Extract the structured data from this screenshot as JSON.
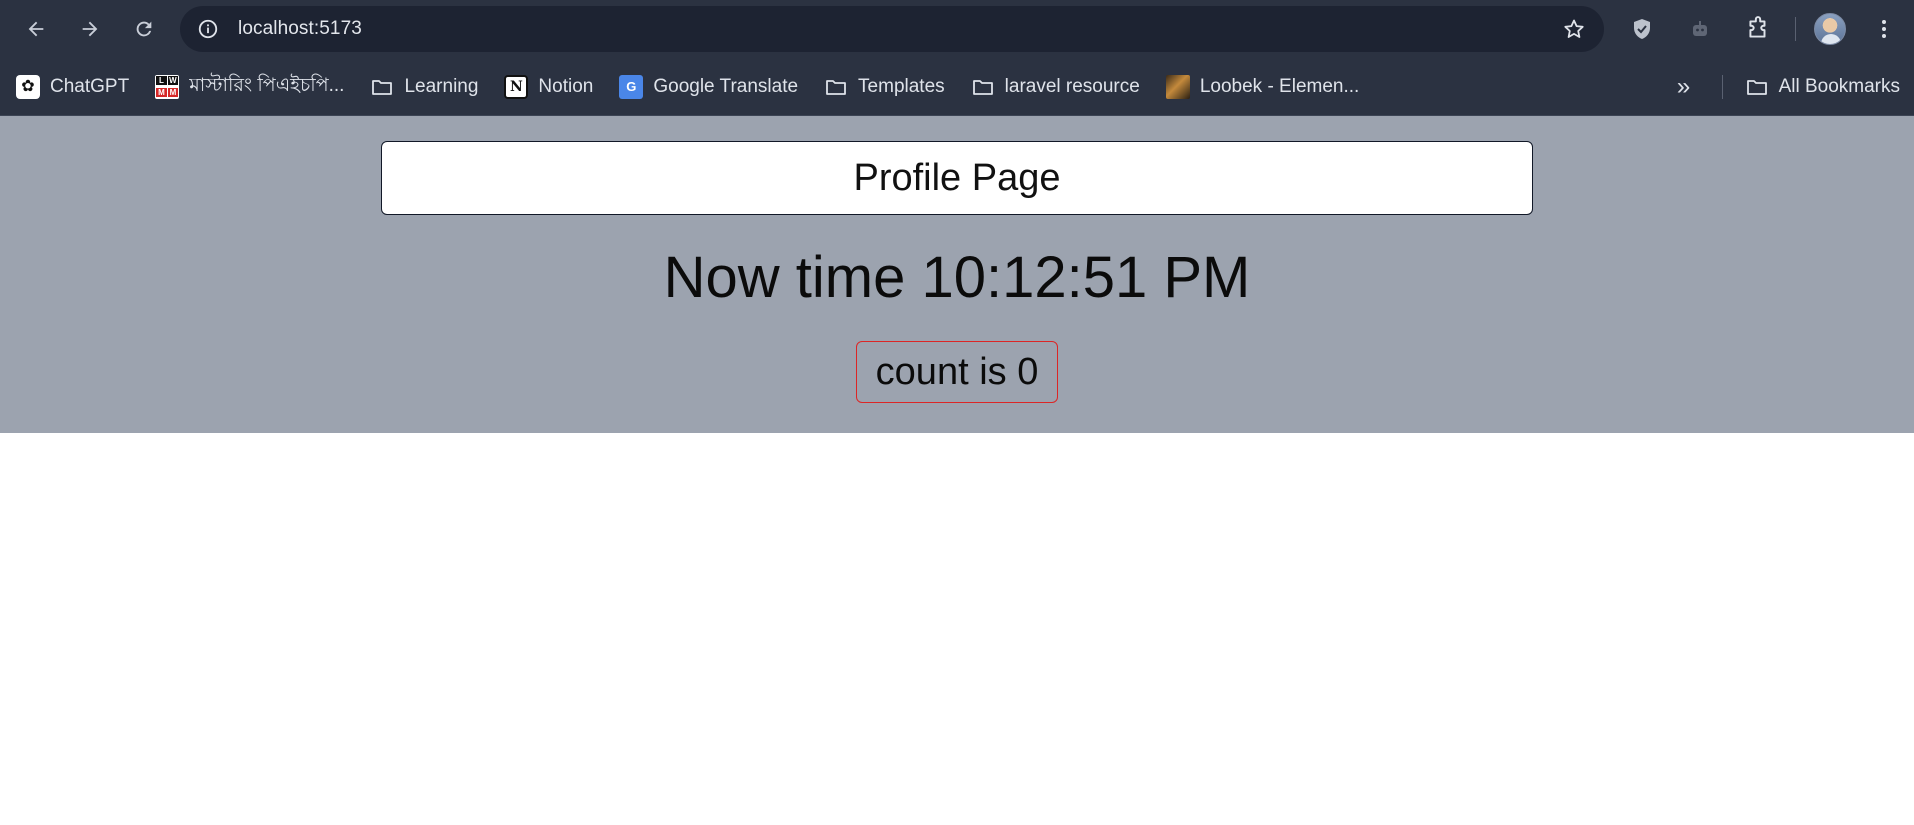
{
  "browser": {
    "url": "localhost:5173",
    "bookmarks": [
      {
        "label": "ChatGPT",
        "icon": "chatgpt-icon"
      },
      {
        "label": "মাস্টারিং পিএইচপি...",
        "icon": "lwm-icon"
      },
      {
        "label": "Learning",
        "icon": "folder-icon"
      },
      {
        "label": "Notion",
        "icon": "notion-icon"
      },
      {
        "label": "Google Translate",
        "icon": "google-translate-icon"
      },
      {
        "label": "Templates",
        "icon": "folder-icon"
      },
      {
        "label": "laravel resource",
        "icon": "folder-icon"
      },
      {
        "label": "Loobek - Elemen...",
        "icon": "loobek-icon"
      }
    ],
    "all_bookmarks_label": "All Bookmarks",
    "lwm_letters": [
      "L",
      "W",
      "M",
      "M"
    ]
  },
  "page": {
    "title": "Profile Page",
    "time_text": "Now time 10:12:51 PM",
    "count_label": "count is 0"
  },
  "colors": {
    "app_background": "#9ca3af",
    "count_border": "#dc2626",
    "chrome_background": "#2b3241"
  }
}
